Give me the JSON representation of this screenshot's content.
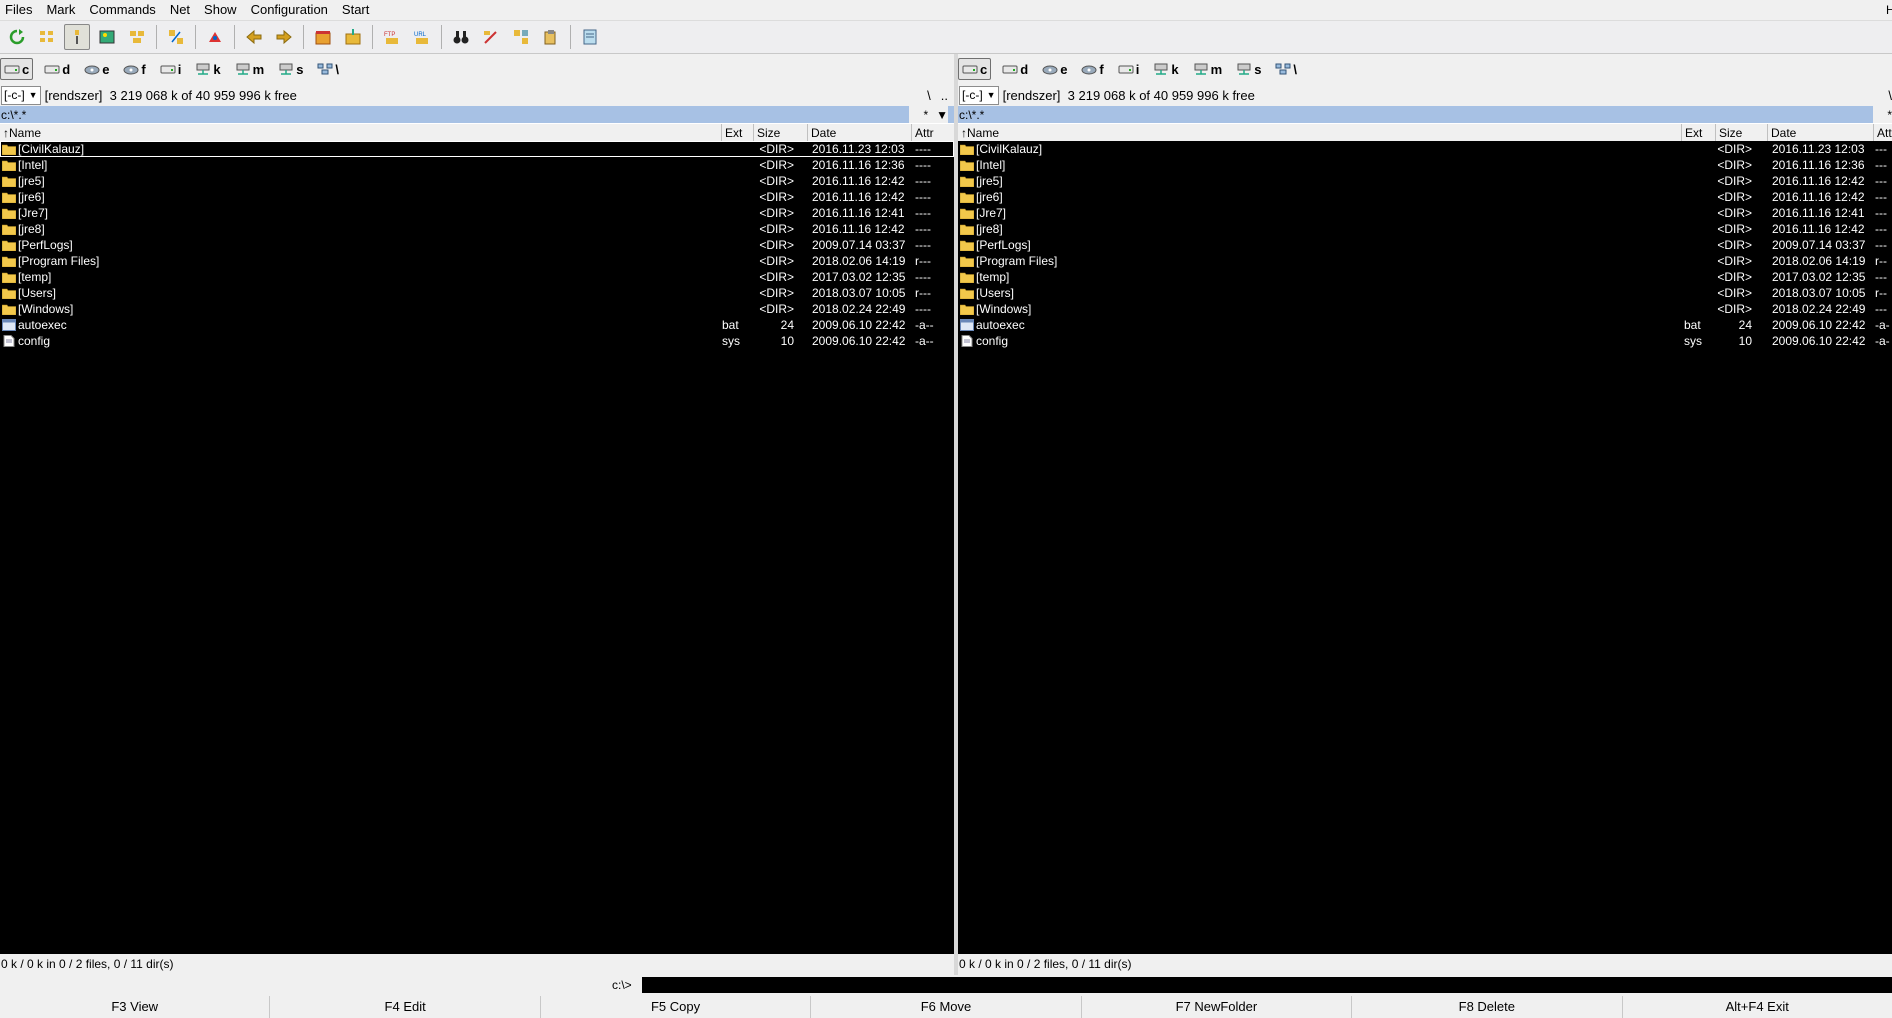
{
  "menu": [
    "Files",
    "Mark",
    "Commands",
    "Net",
    "Show",
    "Configuration",
    "Start"
  ],
  "window_control_fragment": "H",
  "toolbar": {
    "buttons": [
      {
        "name": "refresh-icon",
        "pressed": false
      },
      {
        "name": "brief-view-icon",
        "pressed": false
      },
      {
        "name": "tree-view-icon",
        "pressed": true
      },
      {
        "name": "thumbnail-view-icon",
        "pressed": false
      },
      {
        "name": "invert-selection-icon",
        "pressed": false
      },
      {
        "name": "sep"
      },
      {
        "name": "compare-dirs-icon",
        "pressed": false
      },
      {
        "name": "sep"
      },
      {
        "name": "unpack-icon",
        "pressed": false
      },
      {
        "name": "sep"
      },
      {
        "name": "back-arrow-icon",
        "pressed": false
      },
      {
        "name": "forward-arrow-icon",
        "pressed": false
      },
      {
        "name": "sep"
      },
      {
        "name": "pack-files-icon",
        "pressed": false
      },
      {
        "name": "unpack-files-icon",
        "pressed": false
      },
      {
        "name": "sep"
      },
      {
        "name": "ftp-connect-icon",
        "pressed": false
      },
      {
        "name": "url-connect-icon",
        "pressed": false
      },
      {
        "name": "sep"
      },
      {
        "name": "binoculars-icon",
        "pressed": false
      },
      {
        "name": "multi-rename-icon",
        "pressed": false
      },
      {
        "name": "sync-dirs-icon",
        "pressed": false
      },
      {
        "name": "copy-names-icon",
        "pressed": false
      },
      {
        "name": "sep"
      },
      {
        "name": "notepad-icon",
        "pressed": false
      }
    ]
  },
  "drives": [
    {
      "letter": "c",
      "type": "hdd",
      "active": true
    },
    {
      "letter": "d",
      "type": "hdd",
      "active": false
    },
    {
      "letter": "e",
      "type": "cd",
      "active": false
    },
    {
      "letter": "f",
      "type": "cd",
      "active": false
    },
    {
      "letter": "i",
      "type": "hdd",
      "active": false
    },
    {
      "letter": "k",
      "type": "net",
      "active": false
    },
    {
      "letter": "m",
      "type": "net",
      "active": false
    },
    {
      "letter": "s",
      "type": "net",
      "active": false
    },
    {
      "letter": "\\",
      "type": "network",
      "active": false
    }
  ],
  "left_panel": {
    "drive_select": "[-c-]",
    "volume_label": "[rendszer]",
    "free_space": "3 219 068 k of 40 959 996 k free",
    "nav_root": "\\",
    "nav_up": "..",
    "path": "c:\\*.*",
    "filter": "*",
    "filter_arrow": "▼",
    "columns": {
      "name": "↑Name",
      "ext": "Ext",
      "size": "Size",
      "date": "Date",
      "attr": "Attr"
    },
    "status": "0 k / 0 k in 0 / 2 files, 0 / 11 dir(s)"
  },
  "right_panel": {
    "drive_select": "[-c-]",
    "volume_label": "[rendszer]",
    "free_space": "3 219 068 k of 40 959 996 k free",
    "nav_root": "\\",
    "path": "c:\\*.*",
    "filter": "*",
    "columns": {
      "name": "↑Name",
      "ext": "Ext",
      "size": "Size",
      "date": "Date",
      "attr": "Att"
    },
    "status": "0 k / 0 k in 0 / 2 files, 0 / 11 dir(s)"
  },
  "files_left": [
    {
      "name": "[CivilKalauz]",
      "ext": "",
      "size": "<DIR>",
      "date": "2016.11.23 12:03",
      "attr": "----",
      "type": "dir"
    },
    {
      "name": "[Intel]",
      "ext": "",
      "size": "<DIR>",
      "date": "2016.11.16 12:36",
      "attr": "----",
      "type": "dir"
    },
    {
      "name": "[jre5]",
      "ext": "",
      "size": "<DIR>",
      "date": "2016.11.16 12:42",
      "attr": "----",
      "type": "dir"
    },
    {
      "name": "[jre6]",
      "ext": "",
      "size": "<DIR>",
      "date": "2016.11.16 12:42",
      "attr": "----",
      "type": "dir"
    },
    {
      "name": "[Jre7]",
      "ext": "",
      "size": "<DIR>",
      "date": "2016.11.16 12:41",
      "attr": "----",
      "type": "dir"
    },
    {
      "name": "[jre8]",
      "ext": "",
      "size": "<DIR>",
      "date": "2016.11.16 12:42",
      "attr": "----",
      "type": "dir"
    },
    {
      "name": "[PerfLogs]",
      "ext": "",
      "size": "<DIR>",
      "date": "2009.07.14 03:37",
      "attr": "----",
      "type": "dir"
    },
    {
      "name": "[Program Files]",
      "ext": "",
      "size": "<DIR>",
      "date": "2018.02.06 14:19",
      "attr": "r---",
      "type": "dir"
    },
    {
      "name": "[temp]",
      "ext": "",
      "size": "<DIR>",
      "date": "2017.03.02 12:35",
      "attr": "----",
      "type": "dir"
    },
    {
      "name": "[Users]",
      "ext": "",
      "size": "<DIR>",
      "date": "2018.03.07 10:05",
      "attr": "r---",
      "type": "dir"
    },
    {
      "name": "[Windows]",
      "ext": "",
      "size": "<DIR>",
      "date": "2018.02.24 22:49",
      "attr": "----",
      "type": "dir"
    },
    {
      "name": "autoexec",
      "ext": "bat",
      "size": "24",
      "date": "2009.06.10 22:42",
      "attr": "-a--",
      "type": "bat"
    },
    {
      "name": "config",
      "ext": "sys",
      "size": "10",
      "date": "2009.06.10 22:42",
      "attr": "-a--",
      "type": "sys"
    }
  ],
  "files_right": [
    {
      "name": "[CivilKalauz]",
      "ext": "",
      "size": "<DIR>",
      "date": "2016.11.23 12:03",
      "attr": "---",
      "type": "dir"
    },
    {
      "name": "[Intel]",
      "ext": "",
      "size": "<DIR>",
      "date": "2016.11.16 12:36",
      "attr": "---",
      "type": "dir"
    },
    {
      "name": "[jre5]",
      "ext": "",
      "size": "<DIR>",
      "date": "2016.11.16 12:42",
      "attr": "---",
      "type": "dir"
    },
    {
      "name": "[jre6]",
      "ext": "",
      "size": "<DIR>",
      "date": "2016.11.16 12:42",
      "attr": "---",
      "type": "dir"
    },
    {
      "name": "[Jre7]",
      "ext": "",
      "size": "<DIR>",
      "date": "2016.11.16 12:41",
      "attr": "---",
      "type": "dir"
    },
    {
      "name": "[jre8]",
      "ext": "",
      "size": "<DIR>",
      "date": "2016.11.16 12:42",
      "attr": "---",
      "type": "dir"
    },
    {
      "name": "[PerfLogs]",
      "ext": "",
      "size": "<DIR>",
      "date": "2009.07.14 03:37",
      "attr": "---",
      "type": "dir"
    },
    {
      "name": "[Program Files]",
      "ext": "",
      "size": "<DIR>",
      "date": "2018.02.06 14:19",
      "attr": "r--",
      "type": "dir"
    },
    {
      "name": "[temp]",
      "ext": "",
      "size": "<DIR>",
      "date": "2017.03.02 12:35",
      "attr": "---",
      "type": "dir"
    },
    {
      "name": "[Users]",
      "ext": "",
      "size": "<DIR>",
      "date": "2018.03.07 10:05",
      "attr": "r--",
      "type": "dir"
    },
    {
      "name": "[Windows]",
      "ext": "",
      "size": "<DIR>",
      "date": "2018.02.24 22:49",
      "attr": "---",
      "type": "dir"
    },
    {
      "name": "autoexec",
      "ext": "bat",
      "size": "24",
      "date": "2009.06.10 22:42",
      "attr": "-a-",
      "type": "bat"
    },
    {
      "name": "config",
      "ext": "sys",
      "size": "10",
      "date": "2009.06.10 22:42",
      "attr": "-a-",
      "type": "sys"
    }
  ],
  "cmdline": {
    "prompt": "c:\\>",
    "value": ""
  },
  "fkeys": [
    "F3 View",
    "F4 Edit",
    "F5 Copy",
    "F6 Move",
    "F7 NewFolder",
    "F8 Delete",
    "Alt+F4 Exit"
  ],
  "colors": {
    "list_bg": "#000000",
    "list_fg": "#ffffff",
    "path_bar": "#a7c1e4",
    "folder": "#f2c84b"
  }
}
